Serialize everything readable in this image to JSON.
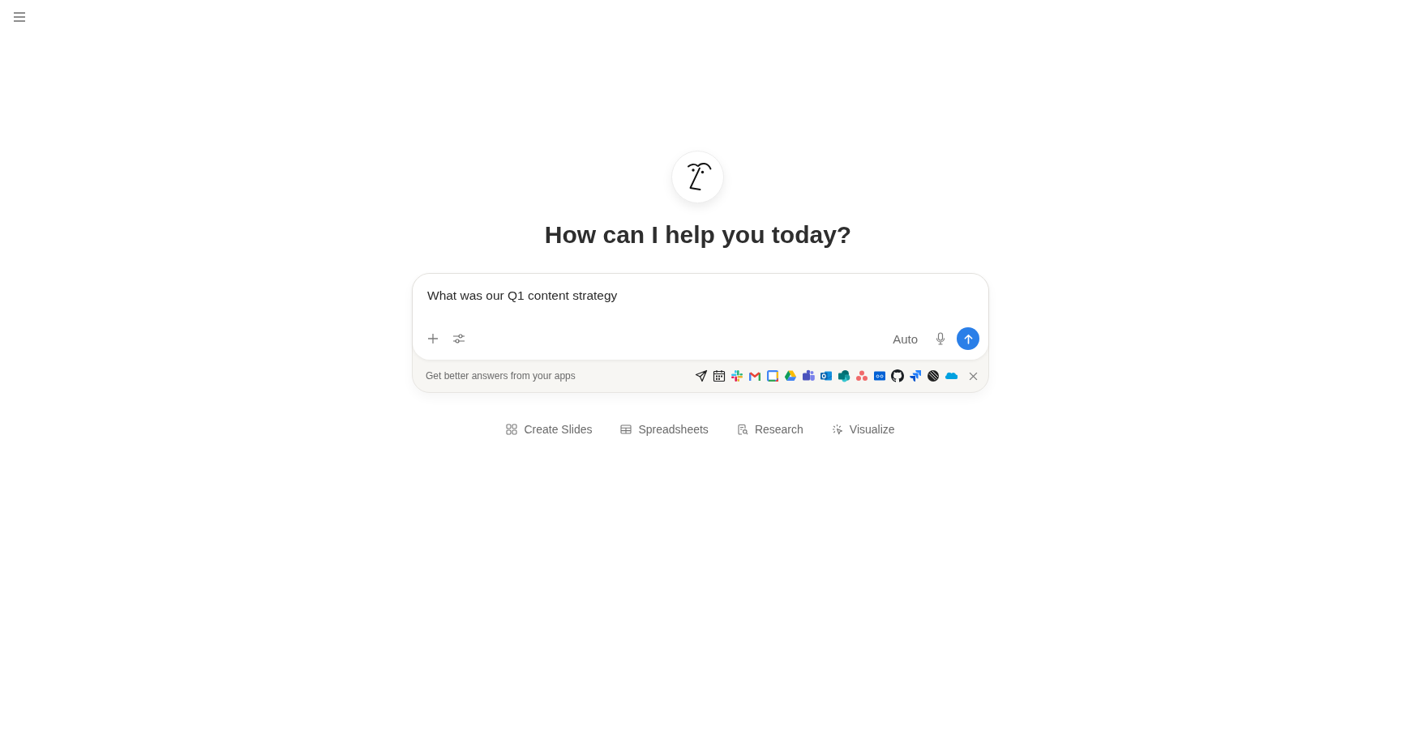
{
  "greeting": {
    "title": "How can I help you today?"
  },
  "composer": {
    "value": "What was our Q1 content strategy",
    "mode": "Auto"
  },
  "apps_banner": {
    "text": "Get better answers from your apps"
  },
  "suggestions": [
    {
      "label": "Create Slides"
    },
    {
      "label": "Spreadsheets"
    },
    {
      "label": "Research"
    },
    {
      "label": "Visualize"
    }
  ]
}
